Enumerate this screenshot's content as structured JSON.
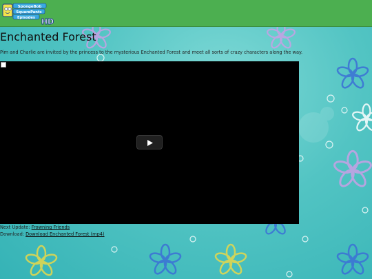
{
  "site": {
    "logo_text_lines": [
      "SpongeBob",
      "SquarePants",
      "Episodes",
      "HD"
    ],
    "header_color": "#4caf50"
  },
  "page": {
    "title": "Enchanted Forest",
    "description": "Pim and Charlie are invited by the princess to the mysterious Enchanted Forest and meet all sorts of crazy characters along the way."
  },
  "video": {
    "play_icon": "play-icon",
    "broken_image_icon": "broken-image-icon"
  },
  "footer": {
    "next_update_label": "Next Update:",
    "next_update_link": "Frowning Friends",
    "download_label": "Download:",
    "download_link": "Download Enchanted Forest (mp4)"
  },
  "colors": {
    "background": "#52c4c3",
    "video_background": "#000000",
    "flower_blue": "#3b6fd6",
    "flower_yellow": "#e8d94a"
  }
}
